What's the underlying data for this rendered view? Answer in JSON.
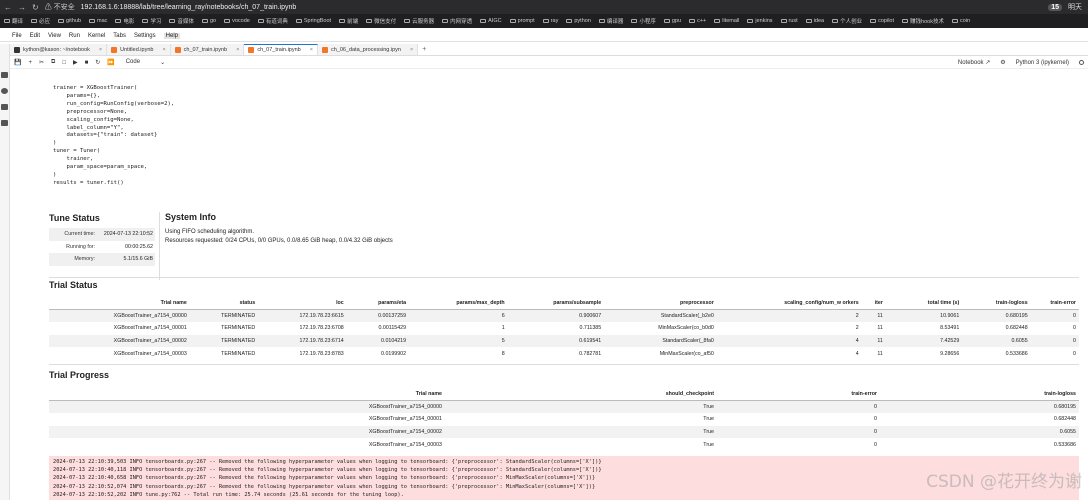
{
  "browser": {
    "security": "不安全",
    "url": "192.168.1.6:18888/lab/tree/learning_ray/notebooks/ch_07_train.ipynb",
    "clock": "15",
    "weather": "明天"
  },
  "bookmarks": [
    "翻译",
    "必应",
    "github",
    "mac",
    "电影",
    "学习",
    "音媒体",
    "go",
    "vocode",
    "有道词典",
    "SpringBoot",
    "前端",
    "微信支付",
    "云服务器",
    "内网穿透",
    "AIGC",
    "prompt",
    "ray",
    "python",
    "编译器",
    "小程序",
    "gpu",
    "c++",
    "litemall",
    "jenkins",
    "rust",
    "idea",
    "个人创业",
    "copilot",
    "赚钱hook技术",
    "coin"
  ],
  "menu": [
    "File",
    "Edit",
    "View",
    "Run",
    "Kernel",
    "Tabs",
    "Settings",
    "Help"
  ],
  "tabs": [
    {
      "label": "kython@kason: ~/notebook"
    },
    {
      "label": "Untitled.ipynb"
    },
    {
      "label": "ch_07_train.ipynb"
    },
    {
      "label": "ch_07_train.ipynb"
    },
    {
      "label": "ch_06_data_processing.ipyn"
    }
  ],
  "toolbar": {
    "cell_type": "Code",
    "notebook_label": "Notebook",
    "kernel_label": "Python 3 (ipykernel)"
  },
  "code_lines": [
    "trainer = XGBoostTrainer(",
    "    params={},",
    "    run_config=RunConfig(verbose=2),",
    "    preprocessor=None,",
    "    scaling_config=None,",
    "    label_column=\"Y\",",
    "    datasets={\"train\": dataset}",
    ")",
    "",
    "tuner = Tuner(",
    "    trainer,",
    "    param_space=param_space,",
    ")",
    "",
    "results = tuner.fit()"
  ],
  "tune_status": {
    "title": "Tune Status",
    "rows": [
      {
        "k": "Current time:",
        "v": "2024-07-13 22:10:52"
      },
      {
        "k": "Running for:",
        "v": "00:00:25.62"
      },
      {
        "k": "Memory:",
        "v": "5.1/15.6 GiB"
      }
    ]
  },
  "system_info": {
    "title": "System Info",
    "line1": "Using FIFO scheduling algorithm.",
    "line2": "Resources requested: 0/24 CPUs, 0/0 GPUs, 0.0/8.65 GiB heap, 0.0/4.32 GiB objects"
  },
  "trial_status": {
    "title": "Trial Status",
    "headers": [
      "Trial name",
      "status",
      "loc",
      "params/eta",
      "params/max_depth",
      "params/subsample",
      "preprocessor",
      "scaling_config/num_w orkers",
      "iter",
      "total time (s)",
      "train-logloss",
      "train-error"
    ],
    "rows": [
      [
        "XGBoostTrainer_a7154_00000",
        "TERMINATED",
        "172.19.78.23:6615",
        "0.00137259",
        "6",
        "0.900607",
        "StandardScaler(_b2e0",
        "2",
        "11",
        "10.9061",
        "0.680195",
        "0"
      ],
      [
        "XGBoostTrainer_a7154_00001",
        "TERMINATED",
        "172.19.78.23:6708",
        "0.00115429",
        "1",
        "0.711385",
        "MinMaxScaler(co_b0d0",
        "2",
        "11",
        "8.53491",
        "0.682448",
        "0"
      ],
      [
        "XGBoostTrainer_a7154_00002",
        "TERMINATED",
        "172.19.78.23:6714",
        "0.0104219",
        "5",
        "0.619541",
        "StandardScaler(_8fa0",
        "4",
        "11",
        "7.42529",
        "0.6055",
        "0"
      ],
      [
        "XGBoostTrainer_a7154_00003",
        "TERMINATED",
        "172.19.78.23:8783",
        "0.0199902",
        "8",
        "0.782781",
        "MinMaxScaler(co_af50",
        "4",
        "11",
        "9.28656",
        "0.533686",
        "0"
      ]
    ]
  },
  "trial_progress": {
    "title": "Trial Progress",
    "headers": [
      "Trial name",
      "should_checkpoint",
      "train-error",
      "train-logloss"
    ],
    "rows": [
      [
        "XGBoostTrainer_a7154_00000",
        "True",
        "0",
        "0.680195"
      ],
      [
        "XGBoostTrainer_a7154_00001",
        "True",
        "0",
        "0.682448"
      ],
      [
        "XGBoostTrainer_a7154_00002",
        "True",
        "0",
        "0.6055"
      ],
      [
        "XGBoostTrainer_a7154_00003",
        "True",
        "0",
        "0.533686"
      ]
    ]
  },
  "log_lines": [
    "2024-07-13 22:10:39,503 INFO tensorboardx.py:267 -- Removed the following hyperparameter values when logging to tensorboard: {'preprocessor': StandardScaler(columns=['X'])}",
    "2024-07-13 22:10:40,118 INFO tensorboardx.py:267 -- Removed the following hyperparameter values when logging to tensorboard: {'preprocessor': StandardScaler(columns=['X'])}",
    "2024-07-13 22:10:40,658 INFO tensorboardx.py:267 -- Removed the following hyperparameter values when logging to tensorboard: {'preprocessor': MinMaxScaler(columns=['X'])}",
    "2024-07-13 22:10:52,074 INFO tensorboardx.py:267 -- Removed the following hyperparameter values when logging to tensorboard: {'preprocessor': MinMaxScaler(columns=['X'])}",
    "2024-07-13 22:10:52,202 INFO tune.py:762 -- Total run time: 25.74 seconds (25.61 seconds for the tuning loop)."
  ],
  "watermark": "CSDN @花开终为谢",
  "icons": {
    "kernel_status": "circle-icon",
    "folder": "folder-icon"
  }
}
